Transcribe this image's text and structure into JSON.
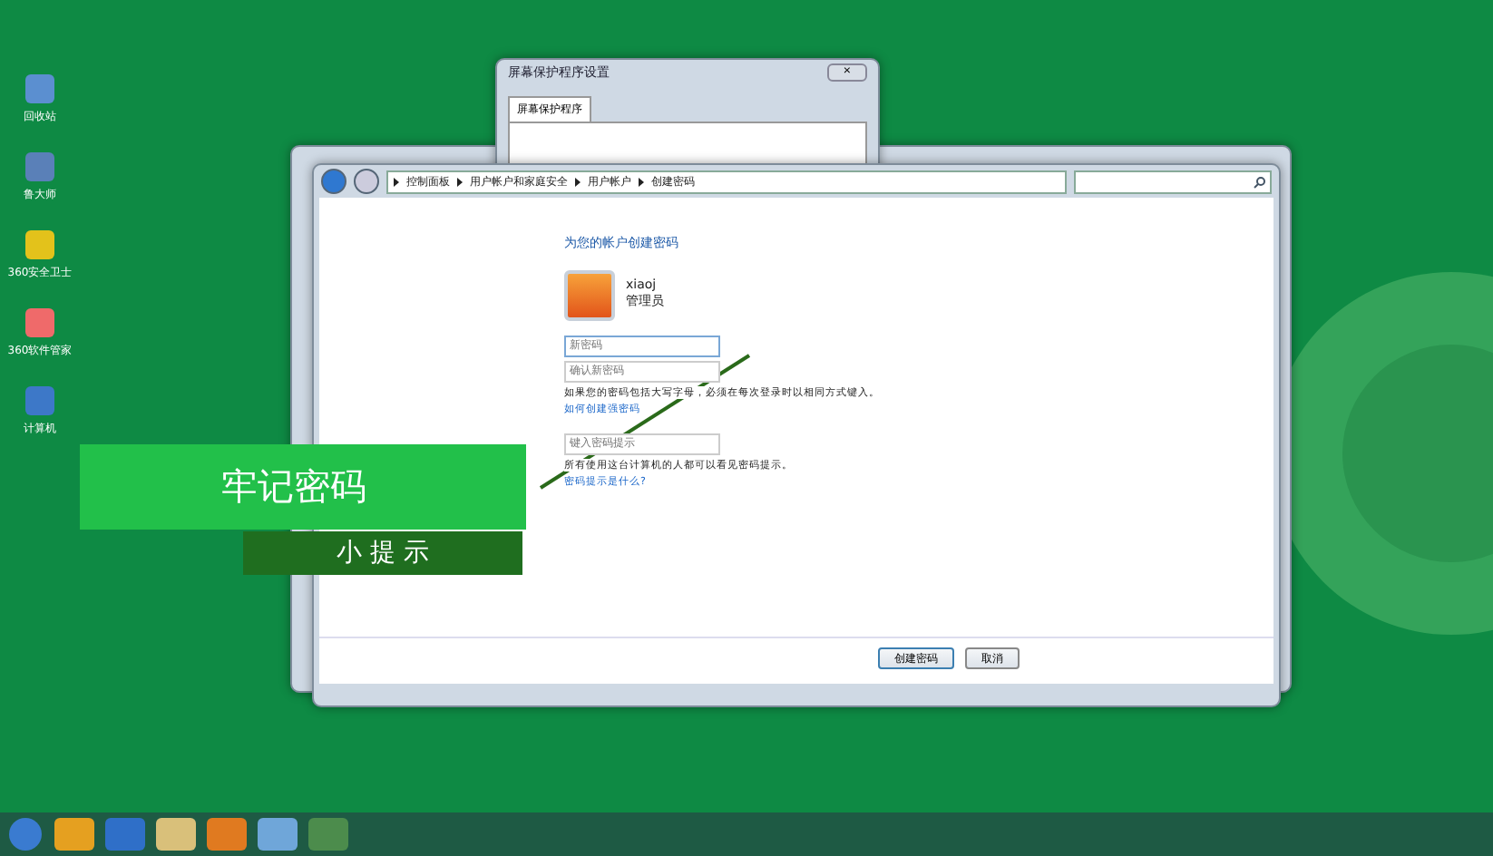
{
  "desktop_icons": [
    {
      "label": "回收站"
    },
    {
      "label": "鲁大师"
    },
    {
      "label": "360安全卫士"
    },
    {
      "label": "360软件管家"
    },
    {
      "label": "计算机"
    }
  ],
  "screensaver_window": {
    "title": "屏幕保护程序设置",
    "close": "×",
    "tabs": [
      {
        "label": "屏幕保护程序",
        "selected": true
      }
    ]
  },
  "main_window": {
    "breadcrumb": [
      "控制面板",
      "用户帐户和家庭安全",
      "用户帐户",
      "创建密码"
    ],
    "heading": "为您的帐户创建密码",
    "user": {
      "name": "xiaoj",
      "role": "管理员"
    },
    "fields": [
      {
        "placeholder": "新密码",
        "focused": true
      },
      {
        "placeholder": "确认新密码",
        "focused": false
      }
    ],
    "caps_note": "如果您的密码包括大写字母，必须在每次登录时以相同方式键入。",
    "strong_link": "如何创建强密码",
    "hint_field": {
      "placeholder": "键入密码提示"
    },
    "hint_note": "所有使用这台计算机的人都可以看见密码提示。",
    "hint_link": "密码提示是什么?",
    "buttons": [
      {
        "label": "创建密码",
        "default": true
      },
      {
        "label": "取消",
        "default": false
      }
    ]
  },
  "caption": {
    "title": "牢记密码",
    "subtitle": "小 提 示"
  }
}
